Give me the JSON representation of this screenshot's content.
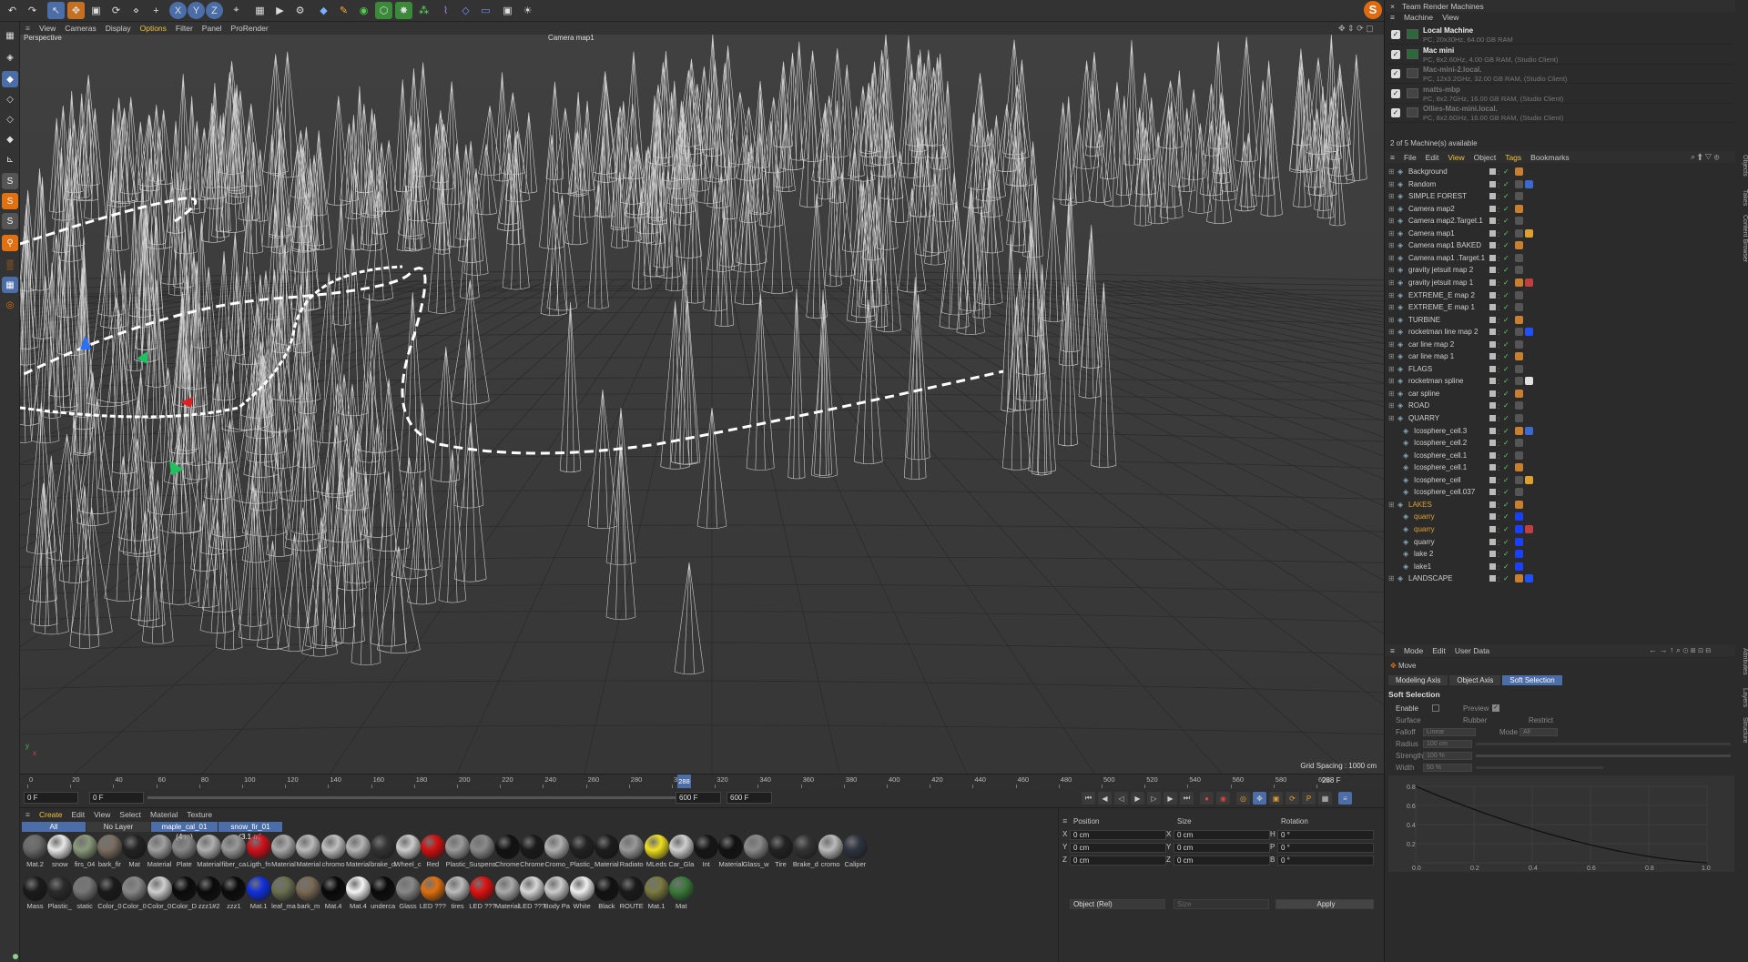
{
  "viewport_menu": [
    "View",
    "Cameras",
    "Display",
    "Options",
    "Filter",
    "Panel",
    "ProRender"
  ],
  "viewport": {
    "projection": "Perspective",
    "camera": "Camera map1",
    "grid_spacing": "Grid Spacing : 1000 cm"
  },
  "timeline": {
    "ticks": [
      "0",
      "20",
      "40",
      "60",
      "80",
      "100",
      "120",
      "140",
      "160",
      "180",
      "200",
      "220",
      "240",
      "260",
      "280",
      "300",
      "320",
      "340",
      "360",
      "380",
      "400",
      "420",
      "440",
      "460",
      "480",
      "500",
      "520",
      "540",
      "560",
      "580",
      "600"
    ],
    "current_frame": "288",
    "end_frame": "288 F",
    "start": "0 F",
    "start2": "0 F",
    "end": "600 F",
    "end2": "600 F"
  },
  "material_manager": {
    "menu": [
      "Create",
      "Edit",
      "View",
      "Select",
      "Material",
      "Texture"
    ],
    "layer_tabs": [
      "All",
      "No Layer",
      "maple_cal_01 (4 m)",
      "snow_fir_01 (3.1 m)"
    ],
    "row1": [
      {
        "label": "Mat.2",
        "color": "#6a6a6a"
      },
      {
        "label": "snow",
        "color": "#e8e8e8"
      },
      {
        "label": "firs_04",
        "color": "#8a9a7a"
      },
      {
        "label": "bark_fir",
        "color": "#7a6e60"
      },
      {
        "label": "Mat",
        "color": "#222222"
      },
      {
        "label": "Material",
        "color": "#a0a0a0"
      },
      {
        "label": "Plate",
        "color": "#888888"
      },
      {
        "label": "Material",
        "color": "#b0b0b0"
      },
      {
        "label": "fiber_ca",
        "color": "#999999"
      },
      {
        "label": "Ligth_fn",
        "color": "#d0101a"
      },
      {
        "label": "Material",
        "color": "#aaaaaa"
      },
      {
        "label": "Material",
        "color": "#bbbbbb"
      },
      {
        "label": "chromo",
        "color": "#c0c0c0"
      },
      {
        "label": "Material",
        "color": "#b5b5b5"
      },
      {
        "label": "brake_d",
        "color": "#333333"
      },
      {
        "label": "Wheel_c",
        "color": "#cccccc"
      },
      {
        "label": "Red",
        "color": "#d01010"
      },
      {
        "label": "Plastic_",
        "color": "#9a9a9a"
      },
      {
        "label": "Suspens",
        "color": "#8a8a8a"
      },
      {
        "label": "Chrome",
        "color": "#111111"
      },
      {
        "label": "Chrome",
        "color": "#1a1a1a"
      },
      {
        "label": "Cromo_",
        "color": "#b0b0b0"
      },
      {
        "label": "Plastic_",
        "color": "#222222"
      },
      {
        "label": "Material",
        "color": "#1c1c1c"
      },
      {
        "label": "Radiato",
        "color": "#999999"
      },
      {
        "label": "MLeds",
        "color": "#f0e020"
      },
      {
        "label": "Car_Gla",
        "color": "#d0d0d0"
      },
      {
        "label": "Int",
        "color": "#151515"
      },
      {
        "label": "Material",
        "color": "#111111"
      },
      {
        "label": "Glass_w",
        "color": "#8a8a8a"
      },
      {
        "label": "Tire",
        "color": "#222222"
      },
      {
        "label": "Brake_d",
        "color": "#333333"
      },
      {
        "label": "cromo",
        "color": "#bbbbbb"
      },
      {
        "label": "Caliper",
        "color": "#2e3440"
      }
    ],
    "row2": [
      {
        "label": "Mass",
        "color": "#1a1a1a"
      },
      {
        "label": "Plastic_",
        "color": "#2a2a2a"
      },
      {
        "label": "static",
        "color": "#777777"
      },
      {
        "label": "Color_0",
        "color": "#1a1a1a"
      },
      {
        "label": "Color_0",
        "color": "#888888"
      },
      {
        "label": "Color_0",
        "color": "#cfcfcf"
      },
      {
        "label": "Color_D",
        "color": "#0a0a0a"
      },
      {
        "label": "zzz1#2",
        "color": "#0a0a0a"
      },
      {
        "label": "zzz1",
        "color": "#0a0a0a"
      },
      {
        "label": "Mat.1",
        "color": "#1030e0"
      },
      {
        "label": "leaf_ma",
        "color": "#6a7050"
      },
      {
        "label": "bark_m",
        "color": "#7a6a55"
      },
      {
        "label": "Mat.4",
        "color": "#080808"
      },
      {
        "label": "Mat.4",
        "color": "#f5f5f5"
      },
      {
        "label": "underca",
        "color": "#0a0a0a"
      },
      {
        "label": "Glass",
        "color": "#888888"
      },
      {
        "label": "LED ???",
        "color": "#e07010"
      },
      {
        "label": "tires",
        "color": "#bbbbbb"
      },
      {
        "label": "LED ???",
        "color": "#e01010"
      },
      {
        "label": "Material",
        "color": "#aaaaaa"
      },
      {
        "label": "LED ???",
        "color": "#d8d8d8"
      },
      {
        "label": "Body Pa",
        "color": "#cccccc"
      },
      {
        "label": "White",
        "color": "#f0f0f0"
      },
      {
        "label": "Black",
        "color": "#111111"
      },
      {
        "label": "ROUTE",
        "color": "#1a1a1a"
      },
      {
        "label": "Mat.1",
        "color": "#7a7a40"
      },
      {
        "label": "Mat",
        "color": "#3a7a3a"
      }
    ]
  },
  "coordinates": {
    "headers": [
      "Position",
      "Size",
      "Rotation"
    ],
    "rows": [
      {
        "axis": "X",
        "pos": "0 cm",
        "saxis": "X",
        "size": "0 cm",
        "raxis": "H",
        "rot": "0 °"
      },
      {
        "axis": "Y",
        "pos": "0 cm",
        "saxis": "Y",
        "size": "0 cm",
        "raxis": "P",
        "rot": "0 °"
      },
      {
        "axis": "Z",
        "pos": "0 cm",
        "saxis": "Z",
        "size": "0 cm",
        "raxis": "B",
        "rot": "0 °"
      }
    ],
    "mode": "Object (Rel)",
    "size_mode": "Size",
    "apply": "Apply"
  },
  "team_render": {
    "title": "Team Render Machines",
    "menu": [
      "Machine",
      "View"
    ],
    "machines": [
      {
        "name": "Local Machine",
        "info": "PC, 20x30Hz, 64.00 GB RAM",
        "active": true
      },
      {
        "name": "Mac mini",
        "info": "PC, 8x2.60Hz, 4.00 GB RAM, (Studio Client)",
        "active": true
      },
      {
        "name": "Mac-mini-2.local.",
        "info": "PC, 12x3.2GHz, 32.00 GB RAM, (Studio Client)",
        "active": false
      },
      {
        "name": "matts-mbp",
        "info": "PC, 8x2.7GHz, 16.00 GB RAM, (Studio Client)",
        "active": false
      },
      {
        "name": "Ollies-Mac-mini.local.",
        "info": "PC, 8x2.6GHz, 16.00 GB RAM, (Studio Client)",
        "active": false
      }
    ],
    "available": "2 of 5 Machine(s) available"
  },
  "object_manager": {
    "menu": [
      "File",
      "Edit",
      "View",
      "Object",
      "Tags",
      "Bookmarks"
    ],
    "objects": [
      {
        "name": "Background",
        "color": "#cfcfcf",
        "indent": 0
      },
      {
        "name": "Random",
        "color": "#cfcfcf",
        "indent": 0
      },
      {
        "name": "SIMPLE FOREST",
        "color": "#cfcfcf",
        "indent": 0
      },
      {
        "name": "Camera map2",
        "color": "#cfcfcf",
        "indent": 0
      },
      {
        "name": "Camera map2.Target.1",
        "color": "#cfcfcf",
        "indent": 0
      },
      {
        "name": "Camera map1",
        "color": "#cfcfcf",
        "indent": 0
      },
      {
        "name": "Camera map1 BAKED",
        "color": "#cfcfcf",
        "indent": 0
      },
      {
        "name": "Camera map1 .Target.1",
        "color": "#cfcfcf",
        "indent": 0
      },
      {
        "name": "gravity jetsuit map 2",
        "color": "#cfcfcf",
        "indent": 0
      },
      {
        "name": "gravity jetsuit map 1",
        "color": "#cfcfcf",
        "indent": 0
      },
      {
        "name": "EXTREME_E map 2",
        "color": "#cfcfcf",
        "indent": 0
      },
      {
        "name": "EXTREME_E map 1",
        "color": "#cfcfcf",
        "indent": 0
      },
      {
        "name": "TURBINE",
        "color": "#cfcfcf",
        "indent": 0
      },
      {
        "name": "rocketman line map 2",
        "color": "#cfcfcf",
        "indent": 0
      },
      {
        "name": "car line map 2",
        "color": "#cfcfcf",
        "indent": 0
      },
      {
        "name": "car line map 1",
        "color": "#cfcfcf",
        "indent": 0
      },
      {
        "name": "FLAGS",
        "color": "#cfcfcf",
        "indent": 0
      },
      {
        "name": "rocketman spline",
        "color": "#cfcfcf",
        "indent": 0
      },
      {
        "name": "car spline",
        "color": "#cfcfcf",
        "indent": 0
      },
      {
        "name": "ROAD",
        "color": "#cfcfcf",
        "indent": 0
      },
      {
        "name": "QUARRY",
        "color": "#cfcfcf",
        "indent": 0
      },
      {
        "name": "Icosphere_cell.3",
        "color": "#cfcfcf",
        "indent": 1
      },
      {
        "name": "Icosphere_cell.2",
        "color": "#cfcfcf",
        "indent": 1
      },
      {
        "name": "Icosphere_cell.1",
        "color": "#cfcfcf",
        "indent": 1
      },
      {
        "name": "Icosphere_cell.1",
        "color": "#cfcfcf",
        "indent": 1
      },
      {
        "name": "Icosphere_cell",
        "color": "#cfcfcf",
        "indent": 1
      },
      {
        "name": "Icosphere_cell.037",
        "color": "#cfcfcf",
        "indent": 1
      },
      {
        "name": "LAKES",
        "color": "#e0a030",
        "indent": 0
      },
      {
        "name": "quarry",
        "color": "#e0a030",
        "indent": 1
      },
      {
        "name": "quarry",
        "color": "#e0a030",
        "indent": 1
      },
      {
        "name": "quarry",
        "color": "#cfcfcf",
        "indent": 1
      },
      {
        "name": "lake 2",
        "color": "#cfcfcf",
        "indent": 1
      },
      {
        "name": "lake1",
        "color": "#cfcfcf",
        "indent": 1
      },
      {
        "name": "LANDSCAPE",
        "color": "#cfcfcf",
        "indent": 0
      }
    ]
  },
  "attributes": {
    "menu": [
      "Mode",
      "Edit",
      "User Data"
    ],
    "tool": "Move",
    "tabs": [
      "Modeling Axis",
      "Object Axis",
      "Soft Selection"
    ],
    "section": "Soft Selection",
    "enable": "Enable",
    "preview": "Preview",
    "surface": "Surface",
    "rubber": "Rubber",
    "restrict": "Restrict",
    "falloff": "Falloff",
    "falloff_value": "Linear",
    "mode": "Mode",
    "mode_value": "All",
    "radius": "Radius",
    "radius_value": "100 cm",
    "strength": "Strength",
    "strength_value": "100 %",
    "width": "Width",
    "width_value": "50 %",
    "graph_y": [
      "0.8",
      "0.6",
      "0.4",
      "0.2"
    ],
    "graph_x": [
      "0.0",
      "0.2",
      "0.4",
      "0.6",
      "0.8",
      "1.0"
    ]
  },
  "side_tabs": [
    "Objects",
    "Takes",
    "Content Browser"
  ],
  "side_tabs2": [
    "Attributes",
    "Layers",
    "Structure"
  ]
}
